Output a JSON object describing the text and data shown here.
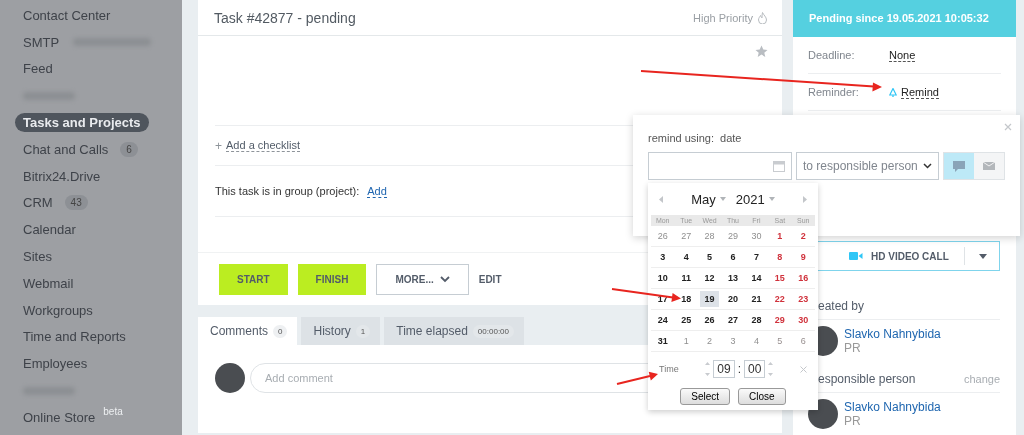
{
  "sidebar": {
    "items": [
      {
        "kind": "link",
        "label": "Contact Center",
        "selected": false
      },
      {
        "kind": "link",
        "label": "SMTP",
        "blurred_suffix": true,
        "selected": false
      },
      {
        "kind": "link",
        "label": "Feed",
        "selected": false
      },
      {
        "kind": "blurred",
        "selected": false
      },
      {
        "kind": "link",
        "label": "Tasks and Projects",
        "selected": true
      },
      {
        "kind": "link",
        "label": "Chat and Calls",
        "badge": "6",
        "selected": false
      },
      {
        "kind": "link",
        "label": "Bitrix24.Drive",
        "selected": false
      },
      {
        "kind": "link",
        "label": "CRM",
        "badge": "43",
        "selected": false
      },
      {
        "kind": "link",
        "label": "Calendar",
        "selected": false
      },
      {
        "kind": "link",
        "label": "Sites",
        "selected": false
      },
      {
        "kind": "link",
        "label": "Webmail",
        "selected": false
      },
      {
        "kind": "link",
        "label": "Workgroups",
        "selected": false
      },
      {
        "kind": "link",
        "label": "Time and Reports",
        "selected": false
      },
      {
        "kind": "link",
        "label": "Employees",
        "selected": false
      },
      {
        "kind": "blurred",
        "selected": false
      },
      {
        "kind": "link",
        "label": "Online Store",
        "sup": "beta",
        "selected": false
      }
    ]
  },
  "task": {
    "title": "Task #42877 - pending",
    "priority": "High Priority",
    "checklist_plus": "+",
    "checklist_link": "Add a checklist",
    "group_label": "This task is in group (project):",
    "group_link": "Add",
    "actions": [
      {
        "kind": "primary",
        "label": "START"
      },
      {
        "kind": "primary",
        "label": "FINISH"
      },
      {
        "kind": "dropdown",
        "label": "MORE..."
      },
      {
        "kind": "link",
        "label": "EDIT"
      }
    ]
  },
  "tabs": [
    {
      "label": "Comments",
      "count": "0",
      "selected": true
    },
    {
      "label": "History",
      "count": "1",
      "selected": false
    },
    {
      "label": "Time elapsed",
      "count": "00:00:00",
      "selected": false
    }
  ],
  "comment": {
    "placeholder": "Add comment"
  },
  "status": {
    "text": "Pending since 19.05.2021 10:05:32"
  },
  "fields": [
    {
      "label": "Deadline:",
      "value": "None"
    },
    {
      "label": "Reminder:",
      "value": "Remind"
    }
  ],
  "video_call": {
    "label": "HD VIDEO CALL"
  },
  "people": [
    {
      "heading": "eated by",
      "name": "Slavko Nahnybida",
      "role": "PR"
    },
    {
      "heading": "esponsible person",
      "action": "change",
      "name": "Slavko Nahnybida",
      "role": "PR"
    }
  ],
  "reminder_popup": {
    "mode_label": "remind using:",
    "mode": "date",
    "recipient": "to responsible person",
    "channels": [
      {
        "kind": "message",
        "selected": true
      },
      {
        "kind": "email",
        "selected": false
      }
    ]
  },
  "calendar": {
    "month": "May",
    "year": "2021",
    "weekdays": [
      "Mon",
      "Tue",
      "Wed",
      "Thu",
      "Fri",
      "Sat",
      "Sun"
    ],
    "weeks": [
      [
        {
          "day": "26",
          "muted": true,
          "weekend": false,
          "selected": false
        },
        {
          "day": "27",
          "muted": true,
          "weekend": false,
          "selected": false
        },
        {
          "day": "28",
          "muted": true,
          "weekend": false,
          "selected": false
        },
        {
          "day": "29",
          "muted": true,
          "weekend": false,
          "selected": false
        },
        {
          "day": "30",
          "muted": true,
          "weekend": false,
          "selected": false
        },
        {
          "day": "1",
          "muted": false,
          "weekend": true,
          "selected": false
        },
        {
          "day": "2",
          "muted": false,
          "weekend": true,
          "selected": false
        }
      ],
      [
        {
          "day": "3",
          "muted": false,
          "weekend": false,
          "selected": false
        },
        {
          "day": "4",
          "muted": false,
          "weekend": false,
          "selected": false
        },
        {
          "day": "5",
          "muted": false,
          "weekend": false,
          "selected": false
        },
        {
          "day": "6",
          "muted": false,
          "weekend": false,
          "selected": false
        },
        {
          "day": "7",
          "muted": false,
          "weekend": false,
          "selected": false
        },
        {
          "day": "8",
          "muted": false,
          "weekend": true,
          "selected": false
        },
        {
          "day": "9",
          "muted": false,
          "weekend": true,
          "selected": false
        }
      ],
      [
        {
          "day": "10",
          "muted": false,
          "weekend": false,
          "selected": false
        },
        {
          "day": "11",
          "muted": false,
          "weekend": false,
          "selected": false
        },
        {
          "day": "12",
          "muted": false,
          "weekend": false,
          "selected": false
        },
        {
          "day": "13",
          "muted": false,
          "weekend": false,
          "selected": false
        },
        {
          "day": "14",
          "muted": false,
          "weekend": false,
          "selected": false
        },
        {
          "day": "15",
          "muted": false,
          "weekend": true,
          "selected": false
        },
        {
          "day": "16",
          "muted": false,
          "weekend": true,
          "selected": false
        }
      ],
      [
        {
          "day": "17",
          "muted": false,
          "weekend": false,
          "selected": false
        },
        {
          "day": "18",
          "muted": false,
          "weekend": false,
          "selected": false
        },
        {
          "day": "19",
          "muted": false,
          "weekend": false,
          "selected": true
        },
        {
          "day": "20",
          "muted": false,
          "weekend": false,
          "selected": false
        },
        {
          "day": "21",
          "muted": false,
          "weekend": false,
          "selected": false
        },
        {
          "day": "22",
          "muted": false,
          "weekend": true,
          "selected": false
        },
        {
          "day": "23",
          "muted": false,
          "weekend": true,
          "selected": false
        }
      ],
      [
        {
          "day": "24",
          "muted": false,
          "weekend": false,
          "selected": false
        },
        {
          "day": "25",
          "muted": false,
          "weekend": false,
          "selected": false
        },
        {
          "day": "26",
          "muted": false,
          "weekend": false,
          "selected": false
        },
        {
          "day": "27",
          "muted": false,
          "weekend": false,
          "selected": false
        },
        {
          "day": "28",
          "muted": false,
          "weekend": false,
          "selected": false
        },
        {
          "day": "29",
          "muted": false,
          "weekend": true,
          "selected": false
        },
        {
          "day": "30",
          "muted": false,
          "weekend": true,
          "selected": false
        }
      ],
      [
        {
          "day": "31",
          "muted": false,
          "weekend": false,
          "selected": false
        },
        {
          "day": "1",
          "muted": true,
          "weekend": false,
          "selected": false
        },
        {
          "day": "2",
          "muted": true,
          "weekend": false,
          "selected": false
        },
        {
          "day": "3",
          "muted": true,
          "weekend": false,
          "selected": false
        },
        {
          "day": "4",
          "muted": true,
          "weekend": false,
          "selected": false
        },
        {
          "day": "5",
          "muted": true,
          "weekend": true,
          "selected": false
        },
        {
          "day": "6",
          "muted": true,
          "weekend": true,
          "selected": false
        }
      ]
    ],
    "time_label": "Time",
    "hour": "09",
    "separator": ":",
    "minute": "00",
    "buttons": [
      "Select",
      "Close"
    ]
  }
}
